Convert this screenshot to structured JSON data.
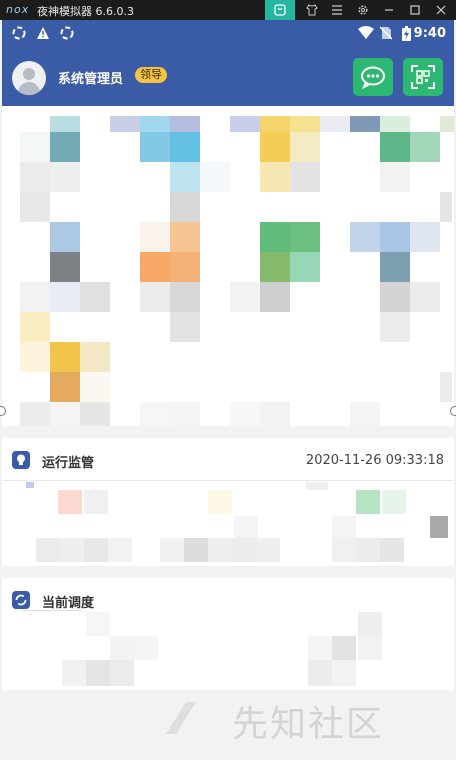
{
  "emulator": {
    "logo": "nox",
    "title": "夜神模拟器 6.6.0.3",
    "toolbar_icons": [
      "store-icon",
      "shirt-icon",
      "menu-icon",
      "settings-icon",
      "minimize-icon",
      "maximize-icon",
      "close-icon"
    ]
  },
  "statusbar": {
    "time": "9:40",
    "left_icons": [
      "sync-icon",
      "warning-icon",
      "sync-icon"
    ],
    "right_icons": [
      "wifi-icon",
      "no-sim-icon",
      "battery-icon"
    ]
  },
  "header": {
    "username": "系统管理员",
    "role": "领导",
    "buttons": [
      "chat-icon",
      "qr-scan-icon"
    ],
    "accent": "#3a5ba5",
    "button_color": "#2db871"
  },
  "sections": {
    "monitor": {
      "title": "运行监管",
      "timestamp": "2020-11-26 09:33:18",
      "icon": "lightbulb-icon"
    },
    "dispatch": {
      "title": "当前调度",
      "icon": "refresh-icon"
    }
  },
  "watermark": "先知社区"
}
